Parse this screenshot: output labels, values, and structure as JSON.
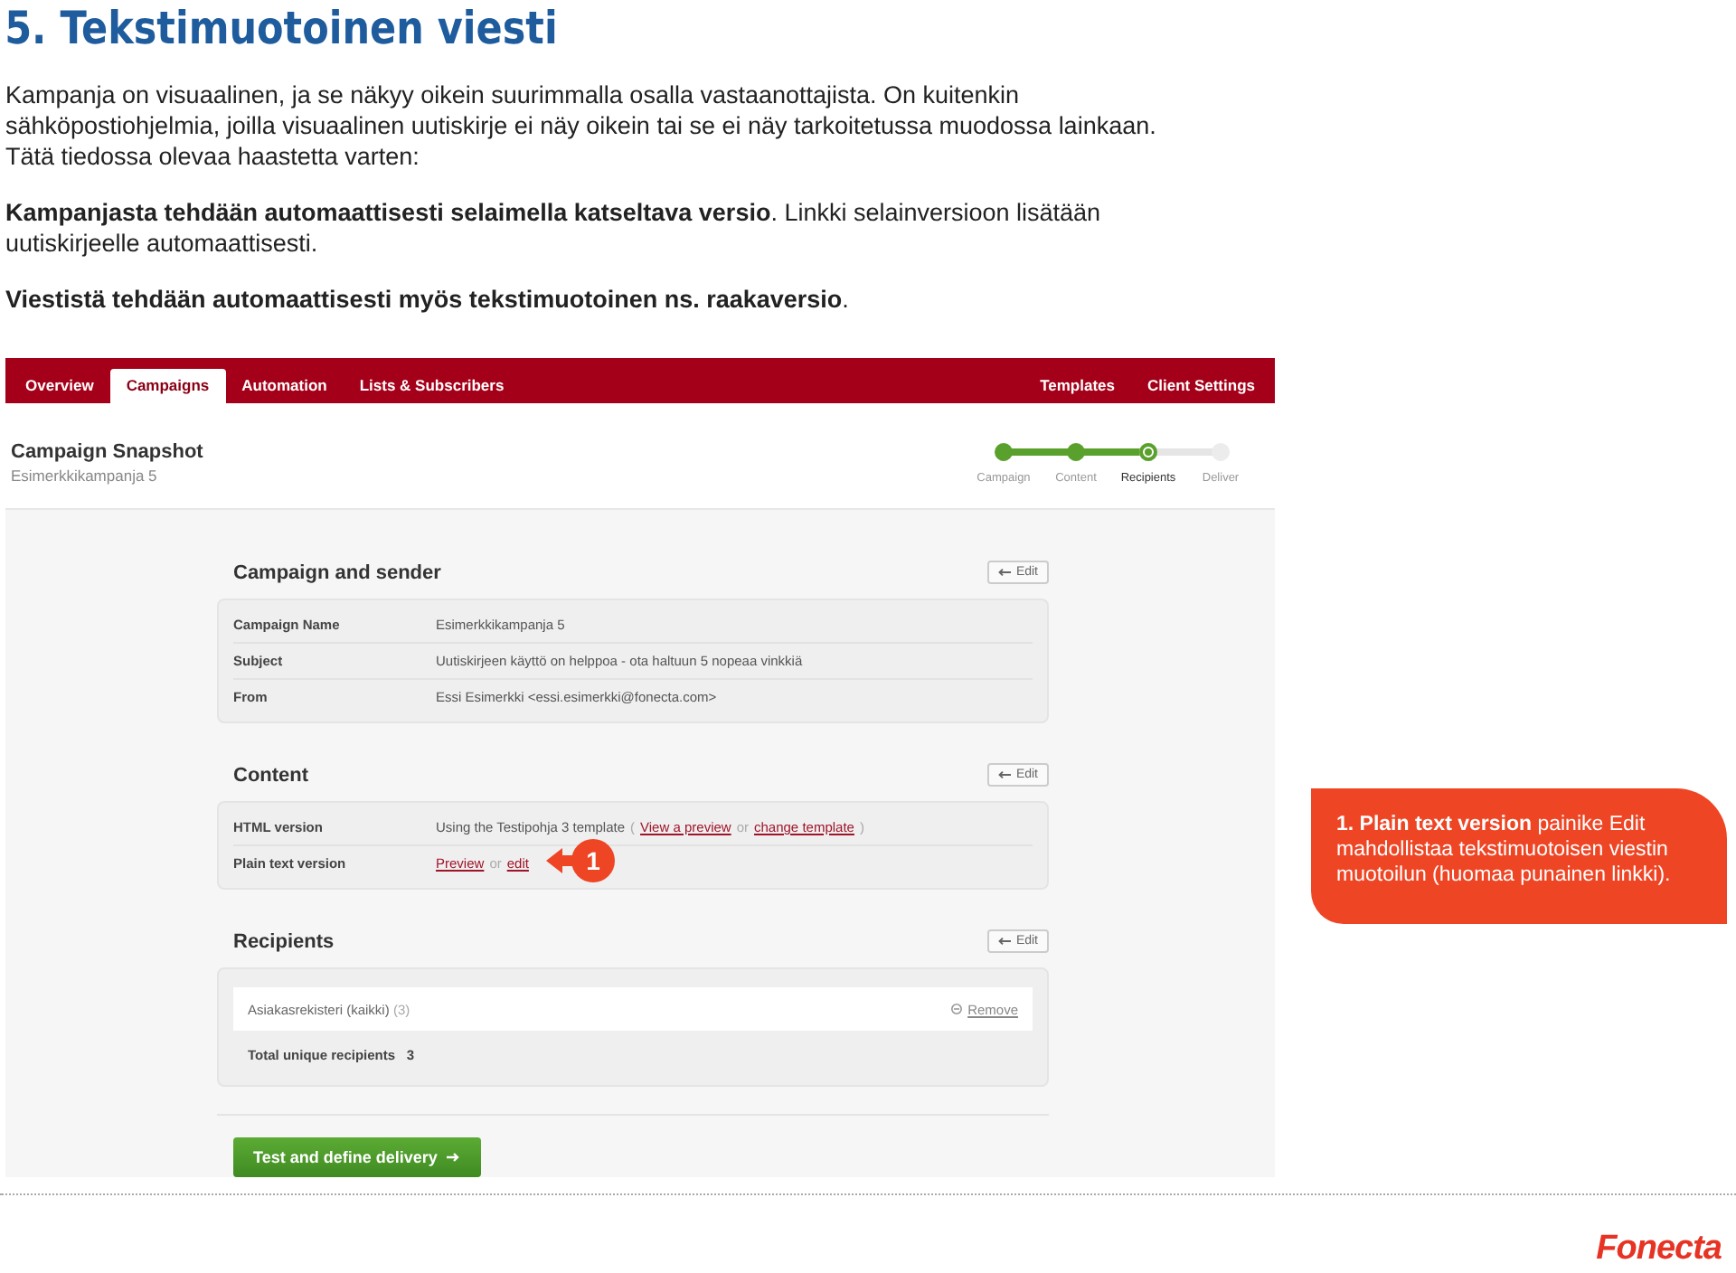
{
  "heading": "5. Tekstimuotoinen viesti",
  "paragraphs": [
    "Kampanja on visuaalinen, ja se näkyy oikein suurimmalla osalla vastaanottajista. On kuitenkin sähköpostiohjelmia, joilla visuaalinen uutiskirje ei näy oikein tai se ei näy tarkoitetussa muodossa lainkaan. Tätä tiedossa olevaa haastetta varten:",
    "**Kampanjasta tehdään automaattisesti selaimella katseltava versio**. Linkki selainversioon lisätään uutiskirjeelle automaattisesti.",
    "**Viestistä tehdään automaattisesti myös tekstimuotoinen ns. raakaversio**."
  ],
  "app": {
    "nav_left": [
      {
        "label": "Overview",
        "selected": false
      },
      {
        "label": "Campaigns",
        "selected": true
      },
      {
        "label": "Automation",
        "selected": false
      },
      {
        "label": "Lists & Subscribers",
        "selected": false
      }
    ],
    "nav_right": [
      {
        "label": "Templates",
        "selected": false
      },
      {
        "label": "Client Settings",
        "selected": false
      }
    ],
    "snapshot": {
      "title": "Campaign Snapshot",
      "subtitle": "Esimerkkikampanja 5"
    },
    "steps": [
      {
        "label": "Campaign",
        "completed": true,
        "selected": false
      },
      {
        "label": "Content",
        "completed": true,
        "selected": false
      },
      {
        "label": "Recipients",
        "completed": false,
        "selected": true
      },
      {
        "label": "Deliver",
        "completed": false,
        "selected": false
      }
    ],
    "campaign_section": {
      "title": "Campaign and sender",
      "edit": "Edit",
      "rows": [
        {
          "label": "Campaign Name",
          "value": "Esimerkkikampanja 5"
        },
        {
          "label": "Subject",
          "value": "Uutiskirjeen käyttö on helppoa - ota haltuun 5 nopeaa vinkkiä"
        },
        {
          "label": "From",
          "value": "Essi Esimerkki <essi.esimerkki@fonecta.com>"
        }
      ]
    },
    "content_section": {
      "title": "Content",
      "edit": "Edit",
      "rows": [
        {
          "label": "HTML version",
          "parts": [
            {
              "kind": "text",
              "text": "Using the Testipohja 3 template"
            },
            {
              "kind": "muted",
              "text": "("
            },
            {
              "kind": "link",
              "text": "View a preview"
            },
            {
              "kind": "muted",
              "text": "or"
            },
            {
              "kind": "link",
              "text": "change template"
            },
            {
              "kind": "muted",
              "text": ")"
            }
          ]
        },
        {
          "label": "Plain text version",
          "parts": [
            {
              "kind": "link",
              "text": "Preview"
            },
            {
              "kind": "muted",
              "text": "or"
            },
            {
              "kind": "link",
              "text": "edit"
            }
          ],
          "marker": "1"
        }
      ]
    },
    "recipients_section": {
      "title": "Recipients",
      "edit": "Edit",
      "list": [
        {
          "name": "Asiakasrekisteri (kaikki)",
          "count": "(3)",
          "action": "Remove"
        }
      ],
      "total_label": "Total unique recipients",
      "total": "3"
    },
    "primary_button": "Test and define delivery"
  },
  "callout": "**1. Plain text version** painike Edit mahdollistaa tekstimuotoisen viestin muotoilun (huomaa punainen linkki).",
  "logo": "Fonecta"
}
